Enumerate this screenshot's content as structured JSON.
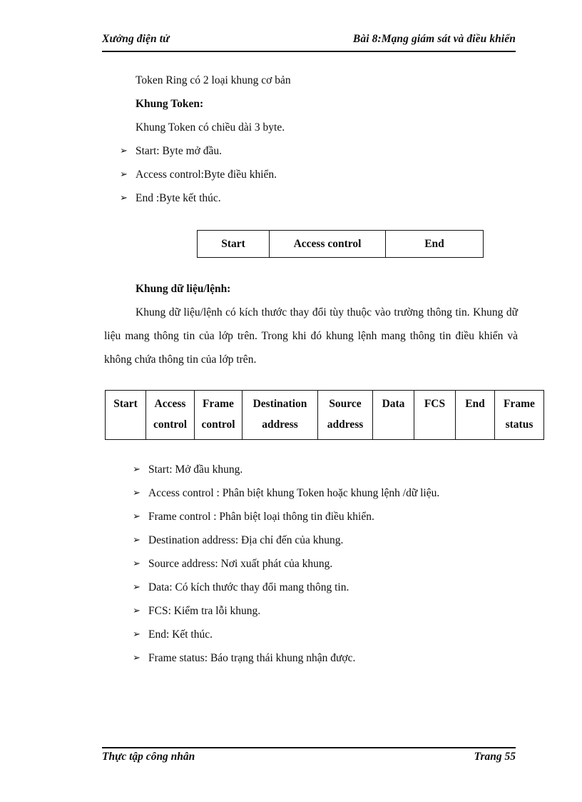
{
  "header": {
    "left": "Xưởng điện tử",
    "right": "Bài 8:Mạng giám sát và điều khiển"
  },
  "content": {
    "intro_line": "Token Ring có 2 loại khung cơ bản",
    "token_heading": "Khung Token:",
    "token_length_line": "Khung Token có chiều dài 3 byte.",
    "token_bullets": [
      {
        "bullet": "➢",
        "text": "Start: Byte mở đầu."
      },
      {
        "bullet": "➢",
        "text": "Access control:Byte điều khiển."
      },
      {
        "bullet": "➢",
        "text": "End :Byte kết thúc."
      }
    ],
    "data_heading": "Khung dữ liệu/lệnh:",
    "data_paragraph": "Khung dữ liệu/lệnh có kích thước thay đổi tùy thuộc vào trường thông tin. Khung dữ liệu mang thông tin của lớp trên. Trong khi đó khung lệnh mang thông tin điều khiển và không chứa thông tin của lớp trên.",
    "data_bullets": [
      {
        "bullet": "➢",
        "text": "Start: Mở đầu khung."
      },
      {
        "bullet": "➢",
        "text": "Access control : Phân biệt khung Token hoặc khung lệnh /dữ liệu."
      },
      {
        "bullet": "➢",
        "text": "Frame control : Phân biệt loại thông tin điều khiển."
      },
      {
        "bullet": "➢",
        "text": "Destination address: Địa chỉ đến của khung."
      },
      {
        "bullet": "➢",
        "text": "Source address: Nơi xuất phát của khung."
      },
      {
        "bullet": "➢",
        "text": "Data: Có kích thước thay đổi mang thông tin."
      },
      {
        "bullet": "➢",
        "text": "FCS: Kiểm tra lỗi khung."
      },
      {
        "bullet": "➢",
        "text": "End: Kết thúc."
      },
      {
        "bullet": "➢",
        "text": "Frame status: Báo trạng thái khung nhận  được."
      }
    ]
  },
  "token_frame_table": {
    "cells": [
      "Start",
      "Access control",
      "End"
    ]
  },
  "data_frame_table": {
    "cells": [
      {
        "line1": "Start",
        "line2": ""
      },
      {
        "line1": "Access",
        "line2": "control"
      },
      {
        "line1": "Frame",
        "line2": "control"
      },
      {
        "line1": "Destination",
        "line2": "address"
      },
      {
        "line1": "Source",
        "line2": "address"
      },
      {
        "line1": "Data",
        "line2": ""
      },
      {
        "line1": "FCS",
        "line2": ""
      },
      {
        "line1": "End",
        "line2": ""
      },
      {
        "line1": "Frame",
        "line2": "status"
      }
    ]
  },
  "footer": {
    "left": "Thực tập công nhân",
    "right": "Trang 55"
  }
}
